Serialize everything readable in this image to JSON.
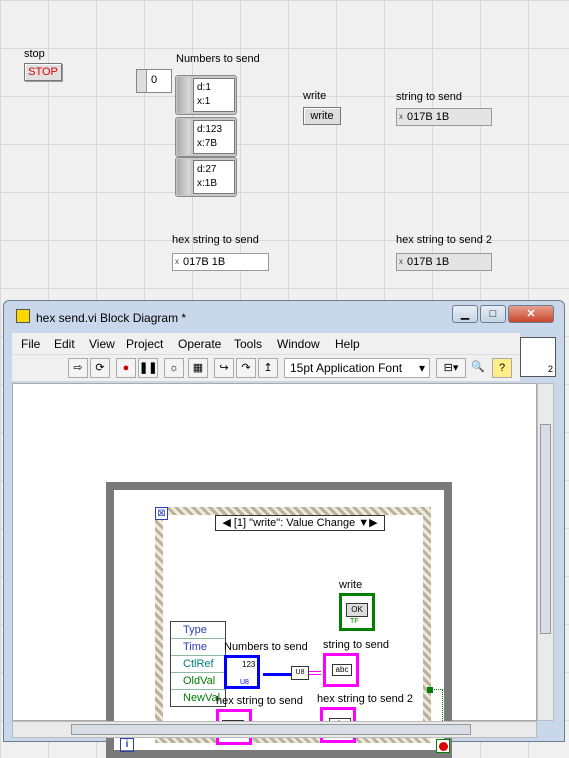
{
  "front_panel": {
    "stop_label": "stop",
    "stop_btn": "STOP",
    "numbers_label": "Numbers to send",
    "index_value": "0",
    "elements": [
      {
        "d": "d:1",
        "x": "x:1"
      },
      {
        "d": "d:123",
        "x": "x:7B"
      },
      {
        "d": "d:27",
        "x": "x:1B"
      }
    ],
    "write_label": "write",
    "write_btn": "write",
    "string_label": "string to send",
    "string_value": "017B 1B",
    "hex_label": "hex string to send",
    "hex_value": "017B 1B",
    "hex2_label": "hex string to send 2",
    "hex2_value": "017B 1B",
    "x_glyph": "x"
  },
  "window": {
    "title": "hex send.vi Block Diagram *",
    "menu": [
      "File",
      "Edit",
      "View",
      "Project",
      "Operate",
      "Tools",
      "Window",
      "Help"
    ],
    "font": "15pt Application Font",
    "conpane_num": "2"
  },
  "diagram": {
    "event_case": "[1] \"write\": Value Change",
    "event_fields": [
      "Type",
      "Time",
      "CtlRef",
      "OldVal",
      "NewVal"
    ],
    "labels": {
      "write": "write",
      "numbers": "Numbers to send",
      "string": "string to send",
      "hex": "hex string to send",
      "hex2": "hex string to send 2"
    },
    "ok": "OK",
    "tf": "TF",
    "abc": "abc",
    "u8": "U8",
    "arr_val": "123",
    "iter": "i",
    "sel_arrow": "▼"
  },
  "colors": {
    "boolean": "#008000",
    "string": "#ff00ff",
    "integer": "#0000ff"
  }
}
